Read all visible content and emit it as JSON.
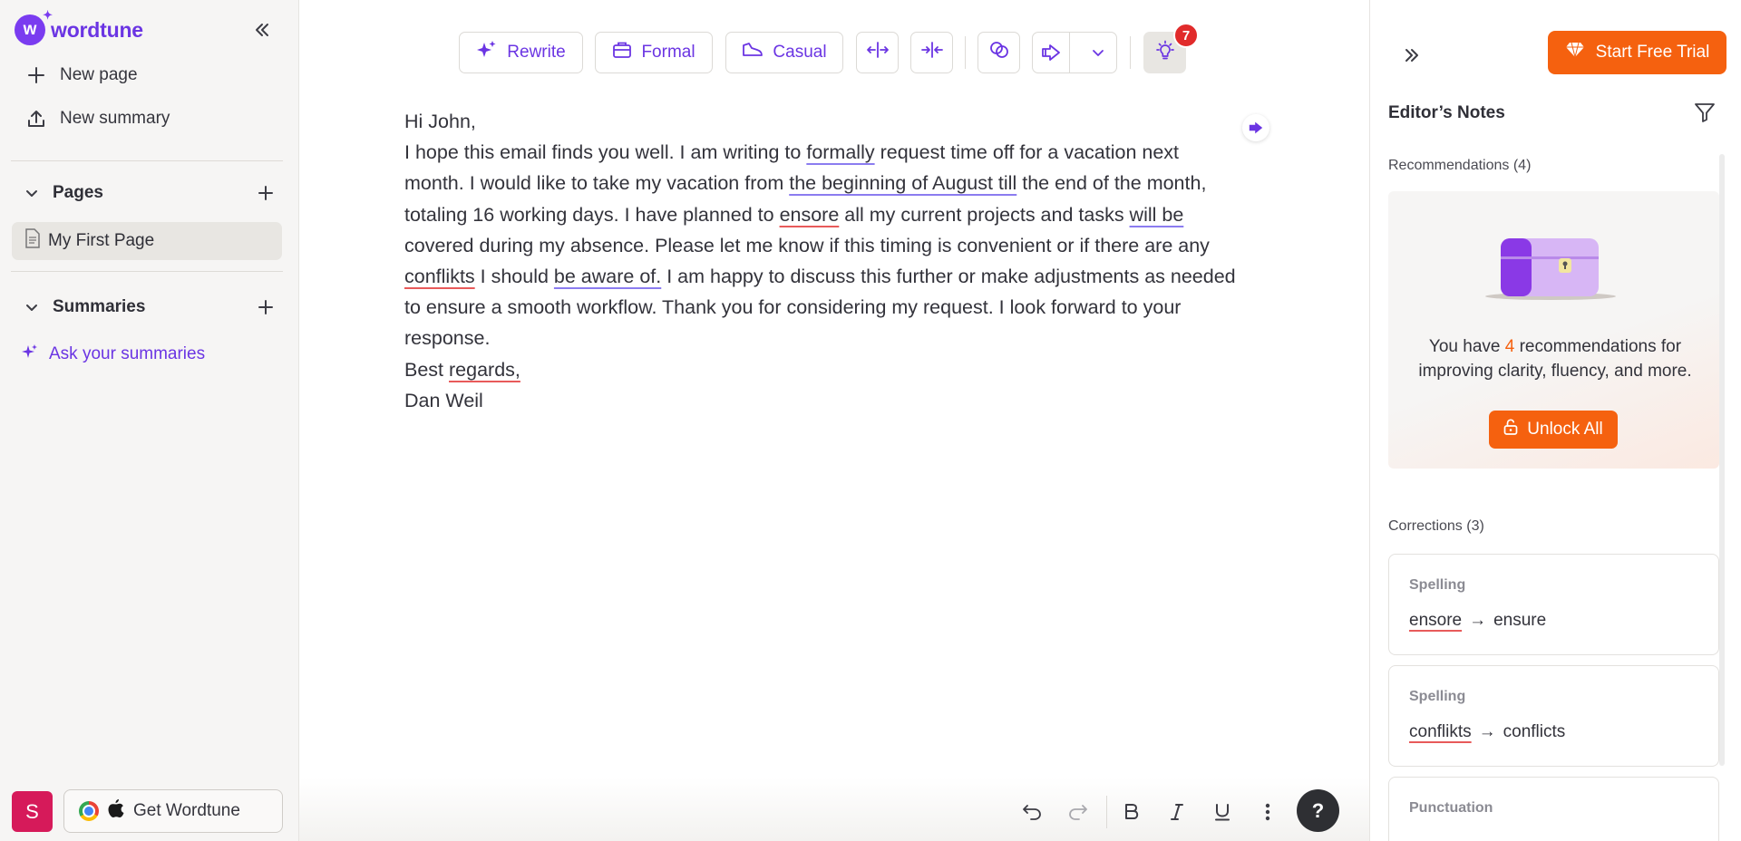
{
  "app": {
    "brand": "wordtune",
    "brand_color": "#6b35e3",
    "accent_color": "#f5610f"
  },
  "sidebar": {
    "new_page": "New page",
    "new_summary": "New summary",
    "pages_heading": "Pages",
    "pages": [
      {
        "label": "My First Page",
        "active": true
      }
    ],
    "summaries_heading": "Summaries",
    "ask_summaries": "Ask your summaries",
    "avatar_initial": "S",
    "get_wordtune": "Get Wordtune"
  },
  "toolbar": {
    "rewrite": "Rewrite",
    "formal": "Formal",
    "casual": "Casual",
    "badge_count": "7"
  },
  "document": {
    "greeting": "Hi John,",
    "body": [
      {
        "t": "I hope this email finds you well. I am writing to "
      },
      {
        "t": "formally",
        "u": "blue"
      },
      {
        "t": " request time off for a vacation next month. I would like to take my vacation from "
      },
      {
        "t": "the beginning of August till",
        "u": "blue"
      },
      {
        "t": " the end of the month, totaling 16 working days. I have planned to "
      },
      {
        "t": "ensore",
        "u": "red"
      },
      {
        "t": " all my current projects and tasks "
      },
      {
        "t": "will be",
        "u": "blue"
      },
      {
        "t": " covered during my absence. Please let me know if this timing is convenient or if there are any "
      },
      {
        "t": "conflikts",
        "u": "red"
      },
      {
        "t": " I should "
      },
      {
        "t": "be aware of.",
        "u": "blue"
      },
      {
        "t": " I am happy to discuss this further or make adjustments as needed to ensure a smooth workflow. Thank you for considering my request. I look forward to your response."
      }
    ],
    "closing_word": "Best ",
    "closing_flagged": "regards,",
    "signature": "Dan Weil"
  },
  "panel": {
    "start_trial": "Start Free Trial",
    "title": "Editor’s Notes",
    "recommendations_heading": "Recommendations (4)",
    "rec_prefix": "You have ",
    "rec_count": "4",
    "rec_suffix": " recommendations for improving clarity, fluency, and more.",
    "unlock_all": "Unlock All",
    "corrections_heading": "Corrections (3)",
    "corrections": [
      {
        "type": "Spelling",
        "from": "ensore",
        "arrow": "→",
        "to": "ensure"
      },
      {
        "type": "Spelling",
        "from": "conflikts",
        "arrow": "→",
        "to": "conflicts"
      },
      {
        "type": "Punctuation"
      }
    ]
  }
}
